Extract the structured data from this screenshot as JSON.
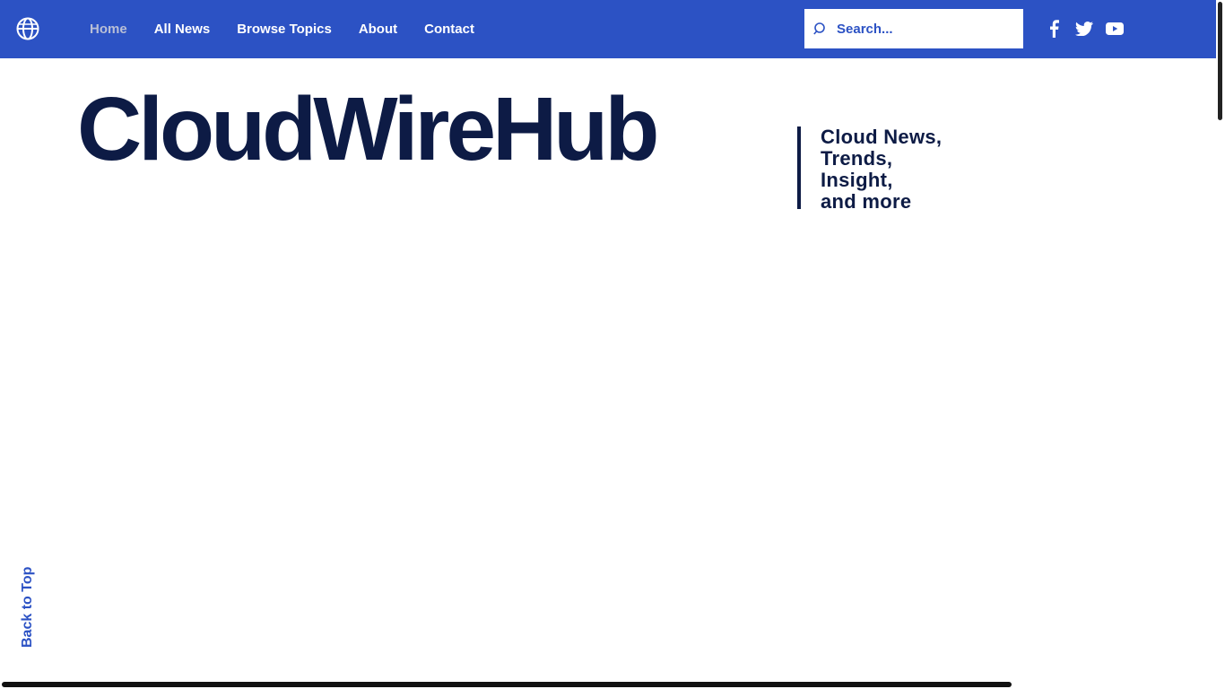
{
  "nav": {
    "logo_icon": "globe-icon",
    "links": [
      {
        "label": "Home",
        "active": true
      },
      {
        "label": "All News"
      },
      {
        "label": "Browse Topics"
      },
      {
        "label": "About"
      },
      {
        "label": "Contact"
      }
    ],
    "search": {
      "placeholder": "Search...",
      "value": ""
    },
    "social": [
      "facebook-icon",
      "twitter-icon",
      "youtube-icon"
    ]
  },
  "hero": {
    "title": "CloudWireHub",
    "tagline": [
      "Cloud News,",
      "Trends,",
      "Insight,",
      "and more"
    ]
  },
  "back_to_top": "Back to Top",
  "colors": {
    "accent": "#2c52c4",
    "title": "#0d1b45",
    "nav_active": "#b9bfd6"
  }
}
